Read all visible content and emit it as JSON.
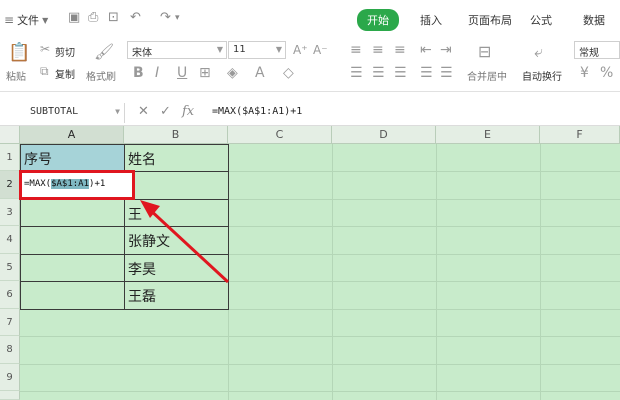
{
  "menubar": {
    "file_label": "文件",
    "tabs": [
      {
        "label": "开始",
        "active": true
      },
      {
        "label": "插入",
        "active": false
      },
      {
        "label": "页面布局",
        "active": false
      },
      {
        "label": "公式",
        "active": false
      },
      {
        "label": "数据",
        "active": false
      }
    ]
  },
  "ribbon": {
    "cut_label": "剪切",
    "copy_label": "复制",
    "paste_label": "粘贴",
    "format_painter_label": "格式刷",
    "font_name": "宋体",
    "font_size": "11",
    "merge_label": "合并居中",
    "wrap_label": "自动换行",
    "number_format": "常规"
  },
  "formula_bar": {
    "name_box": "SUBTOTAL",
    "fx_label": "fx",
    "formula": "=MAX($A$1:A1)+1"
  },
  "sheet": {
    "columns": [
      "A",
      "B",
      "C",
      "D",
      "E",
      "F"
    ],
    "rows": [
      "1",
      "2",
      "3",
      "4",
      "5",
      "6",
      "7",
      "8",
      "9"
    ],
    "cells": {
      "A1": "序号",
      "B1": "姓名",
      "B3": "王",
      "B4": "张静文",
      "B5": "李昊",
      "B6": "王磊"
    },
    "editing": {
      "cell": "A2",
      "prefix": "=MAX(",
      "highlight": "$A$1:A1",
      "suffix": ")+1"
    }
  },
  "colors": {
    "accent": "#2ba84a",
    "sheet_bg": "#c8ebcb",
    "highlight_box": "#e0161f",
    "selected_cell_fill": "#a6d3d8"
  }
}
